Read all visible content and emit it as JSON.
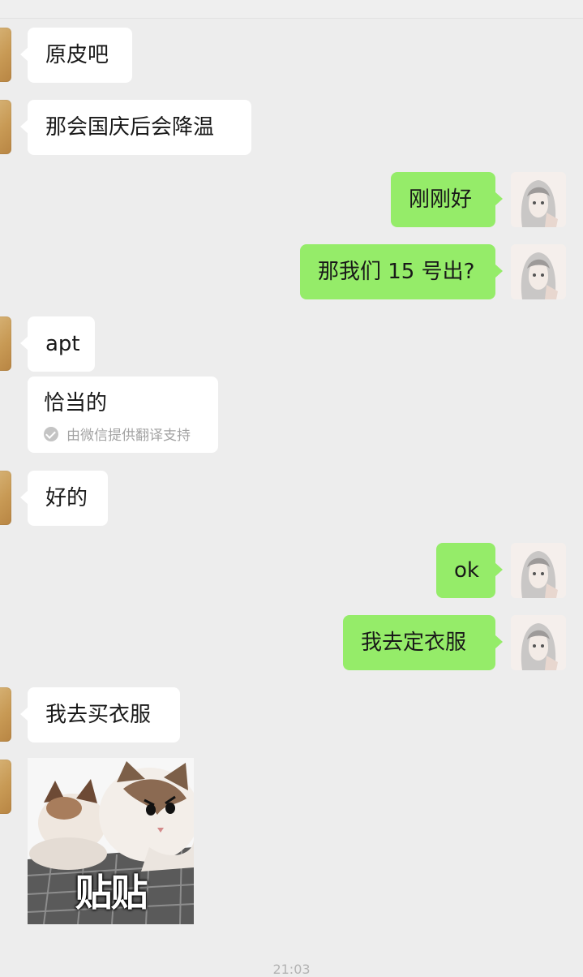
{
  "messages": [
    {
      "side": "in",
      "text": "原皮吧"
    },
    {
      "side": "in",
      "text": "那会国庆后会降温"
    },
    {
      "side": "out",
      "text": "刚刚好"
    },
    {
      "side": "out",
      "text": "那我们 15 号出?"
    },
    {
      "side": "in",
      "text": "apt"
    },
    {
      "side": "in_translation",
      "text": "恰当的",
      "note": "由微信提供翻译支持"
    },
    {
      "side": "in",
      "text": "好的"
    },
    {
      "side": "out",
      "text": "ok"
    },
    {
      "side": "out",
      "text": "我去定衣服"
    },
    {
      "side": "in",
      "text": "我去买衣服"
    },
    {
      "side": "in_sticker",
      "text": "贴贴"
    }
  ],
  "bottom_time": "21:03",
  "colors": {
    "outgoing_bubble": "#95ec69",
    "incoming_bubble": "#ffffff",
    "background": "#ededed"
  },
  "icons": [
    "check-circle-icon"
  ]
}
